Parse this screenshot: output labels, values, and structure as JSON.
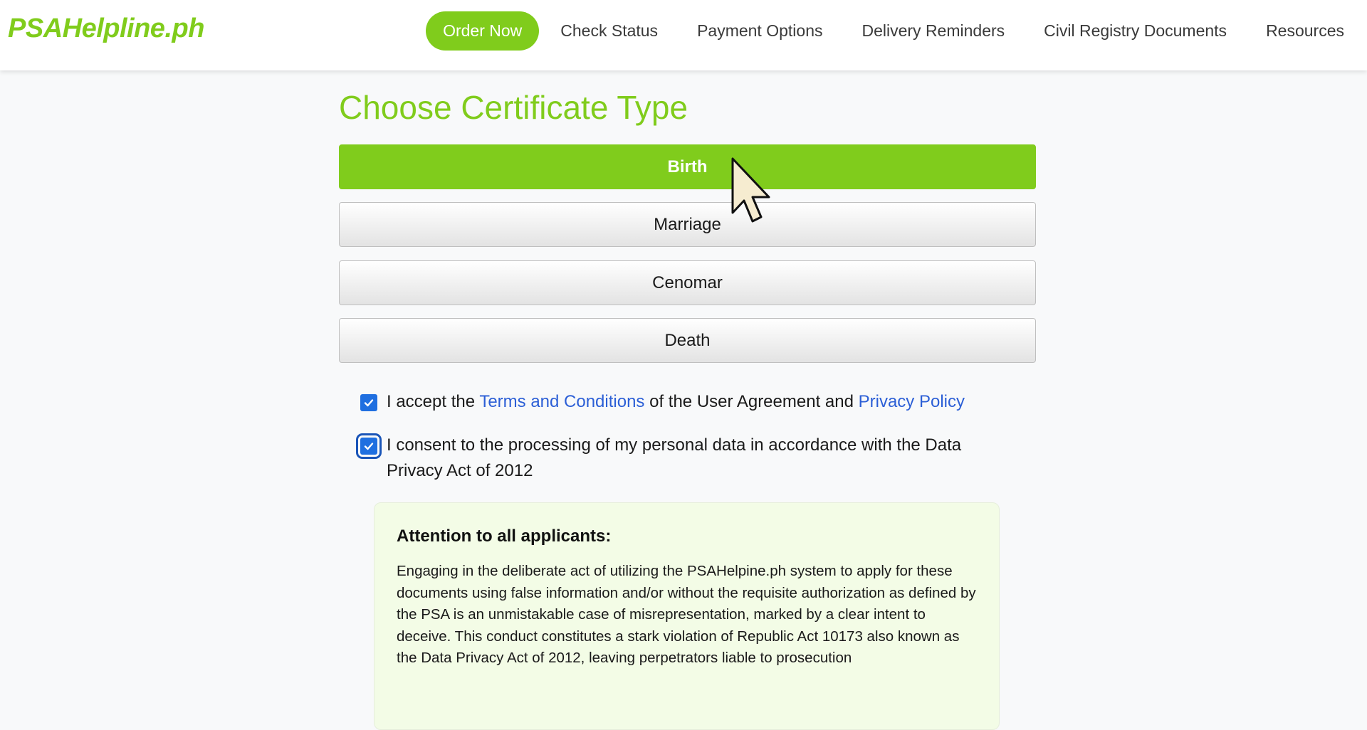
{
  "header": {
    "brand": "PSAHelpline.ph",
    "nav": [
      {
        "label": "Order Now",
        "primary": true
      },
      {
        "label": "Check Status"
      },
      {
        "label": "Payment Options"
      },
      {
        "label": "Delivery Reminders"
      },
      {
        "label": "Civil Registry Documents"
      },
      {
        "label": "Resources"
      }
    ]
  },
  "main": {
    "title": "Choose Certificate Type",
    "certificate_types": [
      {
        "label": "Birth",
        "selected": true
      },
      {
        "label": "Marriage"
      },
      {
        "label": "Cenomar"
      },
      {
        "label": "Death"
      }
    ],
    "terms": {
      "checked": true,
      "prefix": "I accept the ",
      "terms_link": "Terms and Conditions",
      "middle": " of the User Agreement and ",
      "privacy_link": "Privacy Policy"
    },
    "consent": {
      "checked": true,
      "text": "I consent to the processing of my personal data in accordance with the Data Privacy Act of 2012"
    },
    "attention": {
      "title": "Attention to all applicants:",
      "body": "Engaging in the deliberate act of utilizing the PSAHelpine.ph system to apply for these documents using false information and/or without the requisite authorization as defined by the PSA is an unmistakable case of misrepresentation, marked by a clear intent to deceive. This conduct constitutes a stark violation of Republic Act 10173 also known as the Data Privacy Act of 2012, leaving perpetrators liable to prosecution"
    }
  },
  "colors": {
    "brand_green": "#80cc1c",
    "link_blue": "#2c5fd6",
    "checkbox_blue": "#1f6fe0",
    "notice_bg": "#f3fce6"
  },
  "icons": {
    "checkbox": "checkmark-icon",
    "cursor": "mouse-pointer-icon"
  }
}
